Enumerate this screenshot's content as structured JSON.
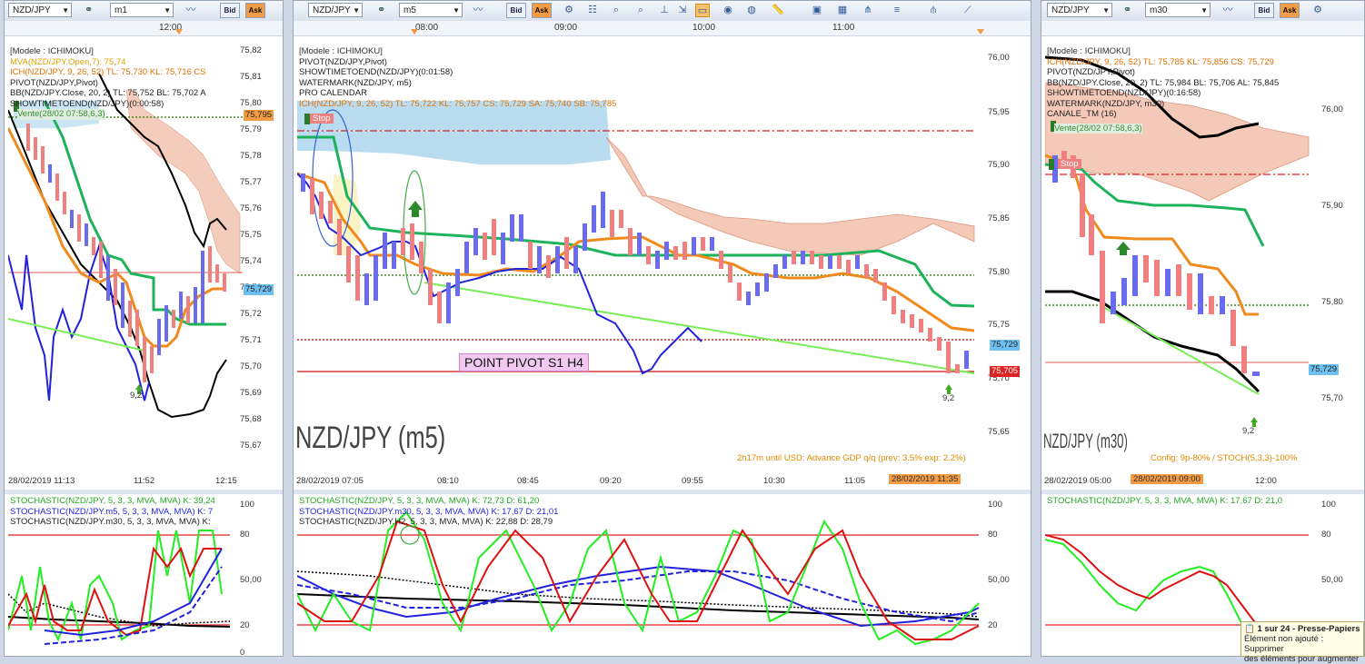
{
  "panels": [
    {
      "symbol": "NZD/JPY",
      "timeframe": "m1",
      "bid": "Bid",
      "ask": "Ask",
      "top_time": "12:00",
      "legend": [
        {
          "text": "[Modele : ICHIMOKU]",
          "color": "#333333"
        },
        {
          "text": "MVA(NZD/JPY.Open,7): 75,74",
          "color": "#e0a000"
        },
        {
          "text": "ICH(NZD/JPY, 9, 26, 52)  TL: 75,730  KL: 75,716  CS",
          "color": "#e07000"
        },
        {
          "text": "PIVOT(NZD/JPY,Pivot)",
          "color": "#000000"
        },
        {
          "text": "BB(NZD/JPY.Close, 20, 2)  TL: 75,752  BL: 75,702  A",
          "color": "#000000"
        },
        {
          "text": "SHOWTIMETOEND(NZD/JPY)(0:00:58)",
          "color": "#000000"
        }
      ],
      "sell_label": "Vente(28/02 07:58,6,3)",
      "price_labels": [
        "75,82",
        "75,81",
        "75,80",
        "75,79",
        "75,78",
        "75,77",
        "75,76",
        "75,75",
        "75,74",
        "75,73",
        "75,72",
        "75,71",
        "75,70",
        "75,69",
        "75,68",
        "75,67"
      ],
      "price_box_1": "75,795",
      "price_box_2": "75,729",
      "signal_label": "9,2",
      "x_labels": [
        "28/02/2019 11:13",
        "11:52",
        "12:15"
      ],
      "osc_legend": [
        {
          "text": "STOCHASTIC(NZD/JPY, 5, 3, 3, MVA, MVA)  K: 39,24",
          "color": "#22aa22"
        },
        {
          "text": "STOCHASTIC(NZD/JPY.m5, 5, 3, 3, MVA, MVA)  K: 7",
          "color": "#2222dd"
        },
        {
          "text": "STOCHASTIC(NZD/JPY.m30, 5, 3, 3, MVA, MVA)  K:",
          "color": "#000000"
        }
      ],
      "osc_levels": [
        "100",
        "80",
        "50,00",
        "20",
        "0"
      ]
    },
    {
      "symbol": "NZD/JPY",
      "timeframe": "m5",
      "bid": "Bid",
      "ask": "Ask",
      "top_times": [
        "08:00",
        "09:00",
        "10:00",
        "11:00"
      ],
      "legend": [
        {
          "text": "[Modele : ICHIMOKU]",
          "color": "#333333"
        },
        {
          "text": "PIVOT(NZD/JPY,Pivot)",
          "color": "#000000"
        },
        {
          "text": "SHOWTIMETOEND(NZD/JPY)(0:01:58)",
          "color": "#000000"
        },
        {
          "text": "WATERMARK(NZD/JPY, m5)",
          "color": "#000000"
        },
        {
          "text": "PRO CALENDAR",
          "color": "#000000"
        },
        {
          "text": "ICH(NZD/JPY, 9, 26, 52)  TL: 75,722  KL: 75,757  CS: 75,729  SA: 75,740  SB: 75,785",
          "color": "#e07000"
        }
      ],
      "stop_label": "Stop",
      "price_labels": [
        "76,00",
        "75,95",
        "75,90",
        "75,85",
        "75,80",
        "75,75",
        "75,70",
        "75,65"
      ],
      "price_box_1": "75,729",
      "price_box_2": "75,705",
      "pivot_label": "POINT PIVOT S1 H4",
      "watermark": "NZD/JPY (m5)",
      "signal_label": "9,2",
      "calendar_note": "2h17m until USD: Advance GDP q/q (prev: 3.5% exp: 2.2%)",
      "x_labels": [
        "28/02/2019 07:05",
        "08:10",
        "08:45",
        "09:20",
        "09:55",
        "10:30",
        "11:05"
      ],
      "x_highlight": "28/02/2019 11:35",
      "osc_legend": [
        {
          "text": "STOCHASTIC(NZD/JPY, 5, 3, 3, MVA, MVA)  K: 72,73  D: 61,20",
          "color": "#22aa22"
        },
        {
          "text": "STOCHASTIC(NZD/JPY.m30, 5, 3, 3, MVA, MVA)  K: 17,67  D: 21,01",
          "color": "#2222dd"
        },
        {
          "text": "STOCHASTIC(NZD/JPY.H2, 5, 3, 3, MVA, MVA)  K: 22,88  D: 28,79",
          "color": "#000000"
        }
      ],
      "osc_levels": [
        "100",
        "80",
        "50,00",
        "20"
      ]
    },
    {
      "symbol": "NZD/JPY",
      "timeframe": "m30",
      "bid": "Bid",
      "ask": "Ask",
      "legend": [
        {
          "text": "[Modele : ICHIMOKU]",
          "color": "#333333"
        },
        {
          "text": "ICH(NZD/JPY, 9, 26, 52)  TL: 75,785  KL: 75,856  CS: 75,729",
          "color": "#e07000"
        },
        {
          "text": "PIVOT(NZD/JPY,Pivot)",
          "color": "#000000"
        },
        {
          "text": "BB(NZD/JPY.Close, 20, 2)  TL: 75,984  BL: 75,706  AL: 75,845",
          "color": "#000000"
        },
        {
          "text": "SHOWTIMETOEND(NZD/JPY)(0:16:58)",
          "color": "#000000"
        },
        {
          "text": "WATERMARK(NZD/JPY, m30)",
          "color": "#000000"
        },
        {
          "text": "CANALE_TM (16)",
          "color": "#000000"
        }
      ],
      "sell_label": "Vente(28/02 07:58,6,3)",
      "stop_label": "Stop",
      "price_labels": [
        "76,00",
        "75,90",
        "75,80",
        "75,70"
      ],
      "price_box_1": "75,729",
      "watermark": "NZD/JPY (m30)",
      "signal_label": "9,2",
      "config_note": "Config: 9p-80% / STOCH(5,3,3)-100%",
      "x_labels": [
        "28/02/2019 05:00",
        "12:00"
      ],
      "x_highlight": "28/02/2019 09:00",
      "osc_legend": [
        {
          "text": "STOCHASTIC(NZD/JPY, 5, 3, 3, MVA, MVA)  K: 17,67  D: 21,0",
          "color": "#22aa22"
        }
      ],
      "osc_levels": [
        "100",
        "80",
        "50,00",
        "20"
      ]
    }
  ],
  "tooltip": {
    "title": "1 sur 24 - Presse-Papiers",
    "line1": "Élément non ajouté : Supprimer",
    "line2": "des éléments pour augmenter"
  },
  "colors": {
    "up_candle": "#6b6bf0",
    "down_candle": "#f08080",
    "kumo_bear": "#f3c4b0",
    "kumo_bull": "#a9d3ee",
    "tenkan": "#f08a1c",
    "kijun": "#1db35a",
    "pivot_line": "#dd2222",
    "ask": "#f29b45"
  }
}
